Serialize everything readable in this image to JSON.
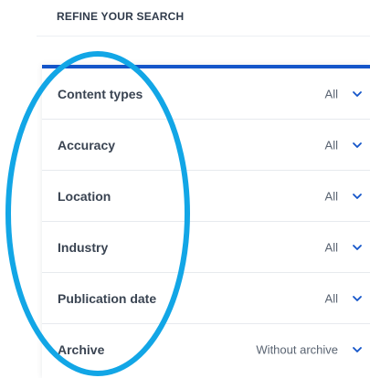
{
  "filters": {
    "heading": "REFINE YOUR SEARCH",
    "accent_color": "#1455c9",
    "rows": [
      {
        "label": "Content types",
        "value": "All"
      },
      {
        "label": "Accuracy",
        "value": "All"
      },
      {
        "label": "Location",
        "value": "All"
      },
      {
        "label": "Industry",
        "value": "All"
      },
      {
        "label": "Publication date",
        "value": "All"
      },
      {
        "label": "Archive",
        "value": "Without archive"
      }
    ],
    "icons": {
      "expand": "chevron-down-icon"
    }
  },
  "annotation": {
    "shape": "ellipse",
    "color": "#12a6e6"
  }
}
